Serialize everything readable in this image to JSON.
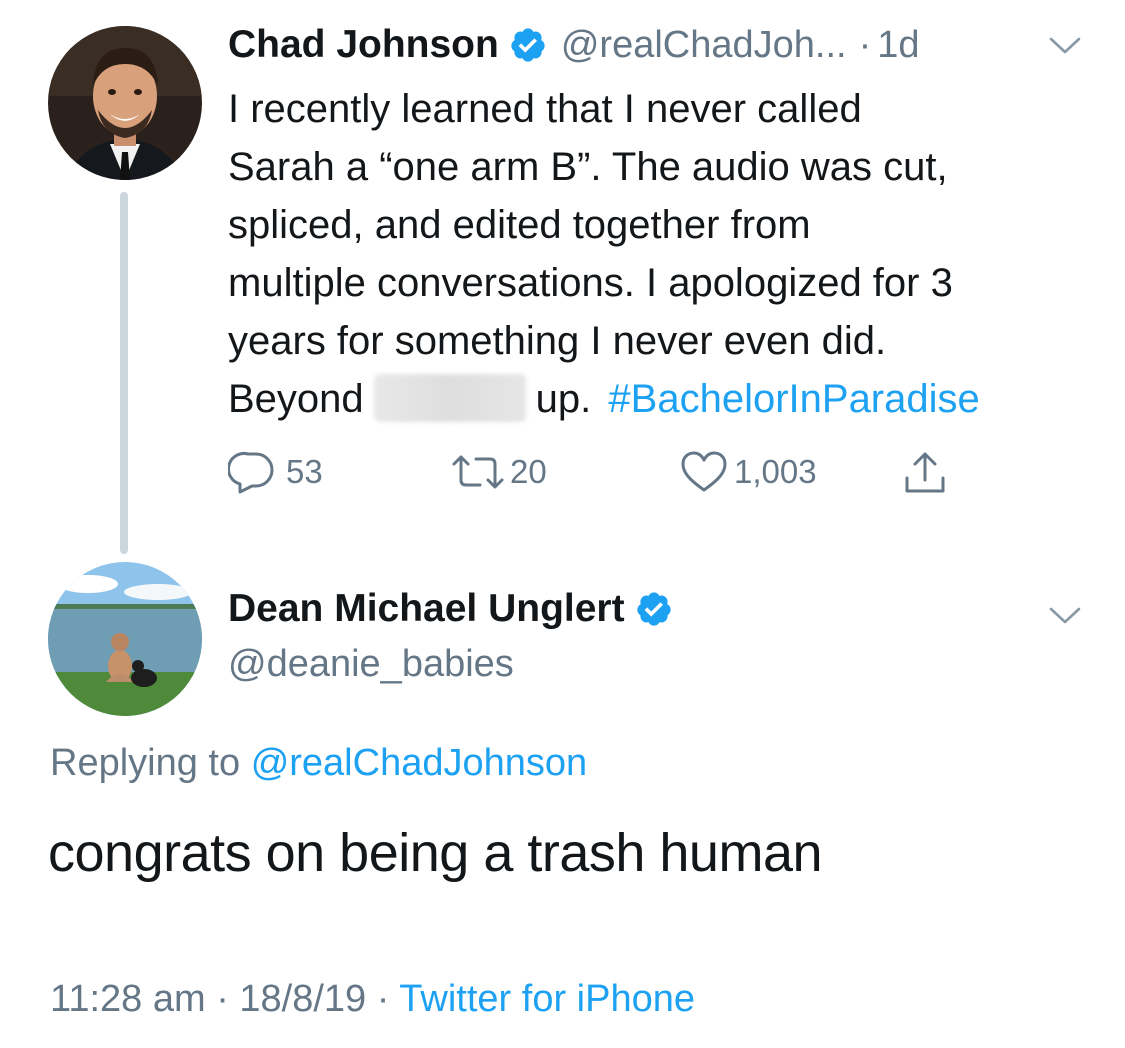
{
  "original_tweet": {
    "author_name": "Chad Johnson",
    "handle": "@realChadJoh...",
    "separator": "·",
    "time_ago": "1d",
    "text_lines": [
      "I recently learned that I never called",
      "Sarah a “one arm B”. The audio was cut,",
      "spliced, and edited together from",
      "multiple conversations. I apologized for 3",
      "years for something I never even did."
    ],
    "last_line_before": "Beyond",
    "last_line_after": "up.",
    "hashtag": "#BachelorInParadise",
    "replies_count": "53",
    "retweets_count": "20",
    "likes_count": "1,003",
    "icons": [
      "verified-badge-icon",
      "chevron-down-icon",
      "reply-icon",
      "retweet-icon",
      "like-icon",
      "share-icon"
    ]
  },
  "reply_tweet": {
    "author_name": "Dean Michael Unglert",
    "handle": "@deanie_babies",
    "replying_to_label": "Replying to",
    "replying_to_handle": "@realChadJohnson",
    "text": "congrats on being a trash human",
    "time": "11:28 am",
    "date": "18/8/19",
    "separator": "·",
    "source": "Twitter for iPhone"
  },
  "colors": {
    "link_blue": "#1da1f2",
    "secondary_gray": "#657786",
    "thread_line": "#ccd6dd",
    "text": "#14171a"
  }
}
